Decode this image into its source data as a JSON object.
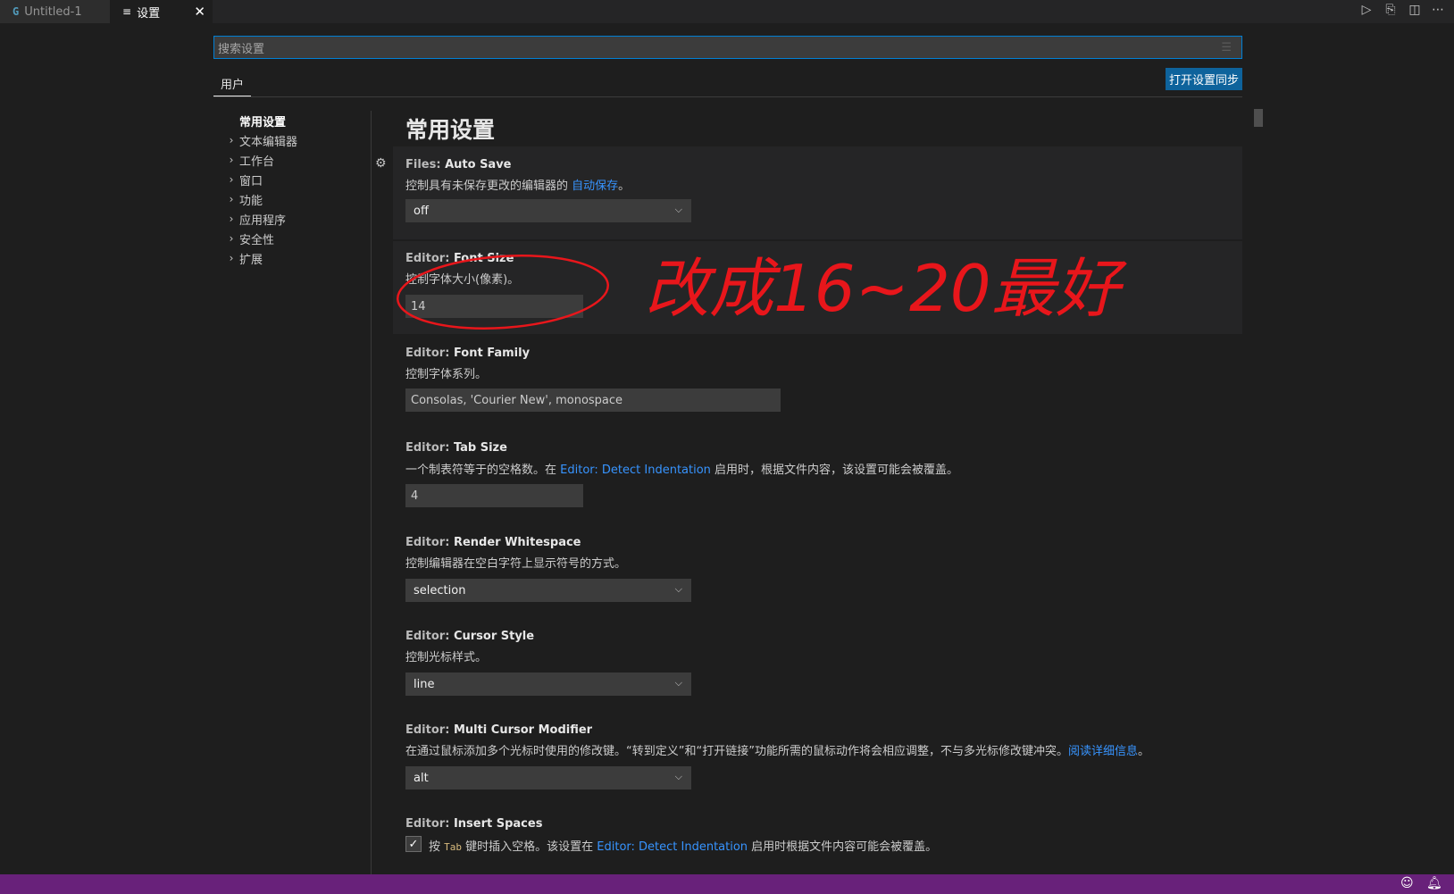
{
  "tabs": [
    {
      "label": "Untitled-1",
      "icon": "ts-file-icon"
    },
    {
      "label": "设置",
      "icon": "settings-list-icon"
    }
  ],
  "tab_close": "✕",
  "search": {
    "placeholder": "搜索设置"
  },
  "scope_tab": "用户",
  "sync_button": "打开设置同步",
  "toc": [
    {
      "label": "常用设置",
      "active": true
    },
    {
      "label": "文本编辑器"
    },
    {
      "label": "工作台"
    },
    {
      "label": "窗口"
    },
    {
      "label": "功能"
    },
    {
      "label": "应用程序"
    },
    {
      "label": "安全性"
    },
    {
      "label": "扩展"
    }
  ],
  "section_title": "常用设置",
  "settings": {
    "auto_save": {
      "category": "Files: ",
      "key": "Auto Save",
      "desc": "控制具有未保存更改的编辑器的 ",
      "desc_link": "自动保存",
      "desc_end": "。",
      "value": "off"
    },
    "font_size": {
      "category": "Editor: ",
      "key": "Font Size",
      "desc": "控制字体大小(像素)。",
      "value": "14"
    },
    "font_family": {
      "category": "Editor: ",
      "key": "Font Family",
      "desc": "控制字体系列。",
      "value": "Consolas, 'Courier New', monospace"
    },
    "tab_size": {
      "category": "Editor: ",
      "key": "Tab Size",
      "desc_pre": "一个制表符等于的空格数。在 ",
      "desc_link": "Editor: Detect Indentation",
      "desc_post": " 启用时，根据文件内容，该设置可能会被覆盖。",
      "value": "4"
    },
    "render_whitespace": {
      "category": "Editor: ",
      "key": "Render Whitespace",
      "desc": "控制编辑器在空白字符上显示符号的方式。",
      "value": "selection"
    },
    "cursor_style": {
      "category": "Editor: ",
      "key": "Cursor Style",
      "desc": "控制光标样式。",
      "value": "line"
    },
    "multi_cursor": {
      "category": "Editor: ",
      "key": "Multi Cursor Modifier",
      "desc": "在通过鼠标添加多个光标时使用的修改键。“转到定义”和“打开链接”功能所需的鼠标动作将会相应调整，不与多光标修改键冲突。",
      "desc_link": "阅读详细信息",
      "desc_end": "。",
      "value": "alt"
    },
    "insert_spaces": {
      "category": "Editor: ",
      "key": "Insert Spaces",
      "desc_pre": "按 ",
      "code": "Tab",
      "desc_mid": " 键时插入空格。该设置在 ",
      "desc_link": "Editor: Detect Indentation",
      "desc_post": " 启用时根据文件内容可能会被覆盖。",
      "checked": true
    }
  },
  "annotation": {
    "text": "改成16~20最好",
    "color": "#e8161b"
  },
  "colors": {
    "accent": "#007fd4",
    "button": "#0e639c",
    "statusbar": "#68217a",
    "link": "#3794ff"
  }
}
